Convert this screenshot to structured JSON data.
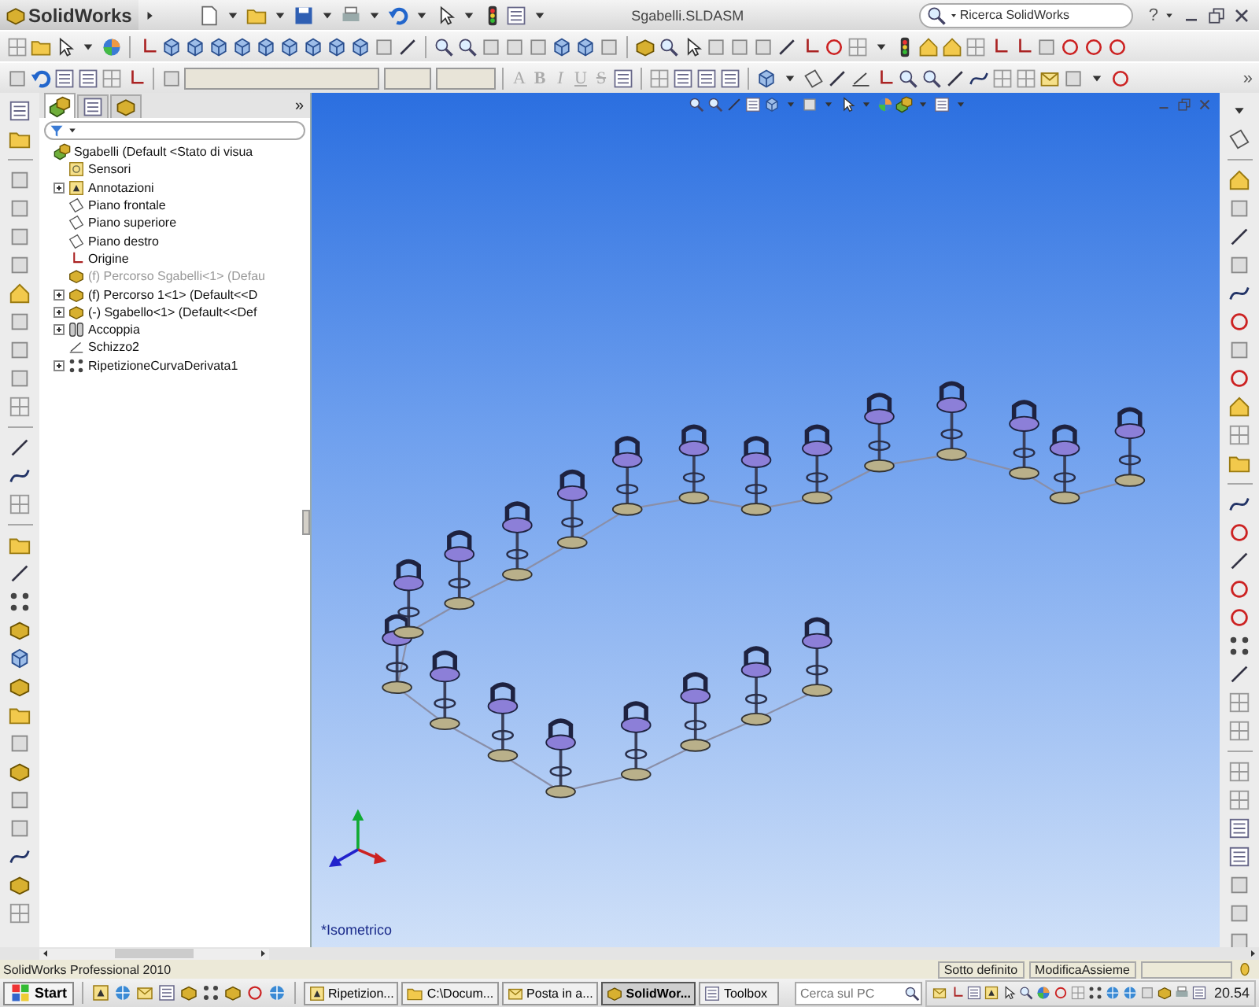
{
  "app": {
    "logo": "SolidWorks",
    "title": "Sgabelli.SLDASM",
    "search": {
      "placeholder": "Ricerca SolidWorks"
    },
    "help": "?"
  },
  "format_toolbar": {
    "buttons": [
      "A",
      "B",
      "I",
      "U",
      "S"
    ],
    "more": "»"
  },
  "tree": {
    "tabs": [
      {
        "kind": "features",
        "selected": true
      },
      {
        "kind": "properties",
        "selected": false
      },
      {
        "kind": "configurations",
        "selected": false
      }
    ],
    "more": "»",
    "root": {
      "label": "Sgabelli (Default <Stato di visua",
      "kind": "assembly",
      "collapsed": false,
      "suppressed": false,
      "children": [
        {
          "label": "Sensori",
          "kind": "sensor",
          "collapsed": false,
          "suppressed": false
        },
        {
          "label": "Annotazioni",
          "kind": "annotation",
          "collapsed": true,
          "suppressed": false
        },
        {
          "label": "Piano frontale",
          "kind": "plane",
          "collapsed": false,
          "suppressed": false
        },
        {
          "label": "Piano superiore",
          "kind": "plane",
          "collapsed": false,
          "suppressed": false
        },
        {
          "label": "Piano destro",
          "kind": "plane",
          "collapsed": false,
          "suppressed": false
        },
        {
          "label": "Origine",
          "kind": "origin",
          "collapsed": false,
          "suppressed": false
        },
        {
          "label": "(f) Percorso Sgabelli<1> (Defau",
          "kind": "part",
          "collapsed": false,
          "suppressed": true
        },
        {
          "label": "(f) Percorso 1<1> (Default<<D",
          "kind": "part",
          "collapsed": true,
          "suppressed": false
        },
        {
          "label": "(-) Sgabello<1> (Default<<Def",
          "kind": "part",
          "collapsed": true,
          "suppressed": false
        },
        {
          "label": "Accoppia",
          "kind": "mates",
          "collapsed": true,
          "suppressed": false
        },
        {
          "label": "Schizzo2",
          "kind": "sketch",
          "collapsed": false,
          "suppressed": false
        },
        {
          "label": "RipetizioneCurvaDerivata1",
          "kind": "pattern",
          "collapsed": true,
          "suppressed": false
        }
      ]
    }
  },
  "viewport": {
    "view_label": "*Isometrico"
  },
  "status_bar": {
    "product": "SolidWorks Professional 2010",
    "state": "Sotto definito",
    "mode": "ModificaAssieme"
  },
  "taskbar": {
    "start": "Start",
    "buttons": [
      {
        "label": "Ripetizion...",
        "kind": "doc",
        "selected": false
      },
      {
        "label": "C:\\Docum...",
        "kind": "folder",
        "selected": false
      },
      {
        "label": "Posta in a...",
        "kind": "mail",
        "selected": false
      },
      {
        "label": "SolidWor...",
        "kind": "cad",
        "selected": true
      },
      {
        "label": "Toolbox",
        "kind": "tools",
        "selected": false
      }
    ],
    "search": {
      "placeholder": "Cerca sul PC"
    },
    "clock": "20.54"
  }
}
